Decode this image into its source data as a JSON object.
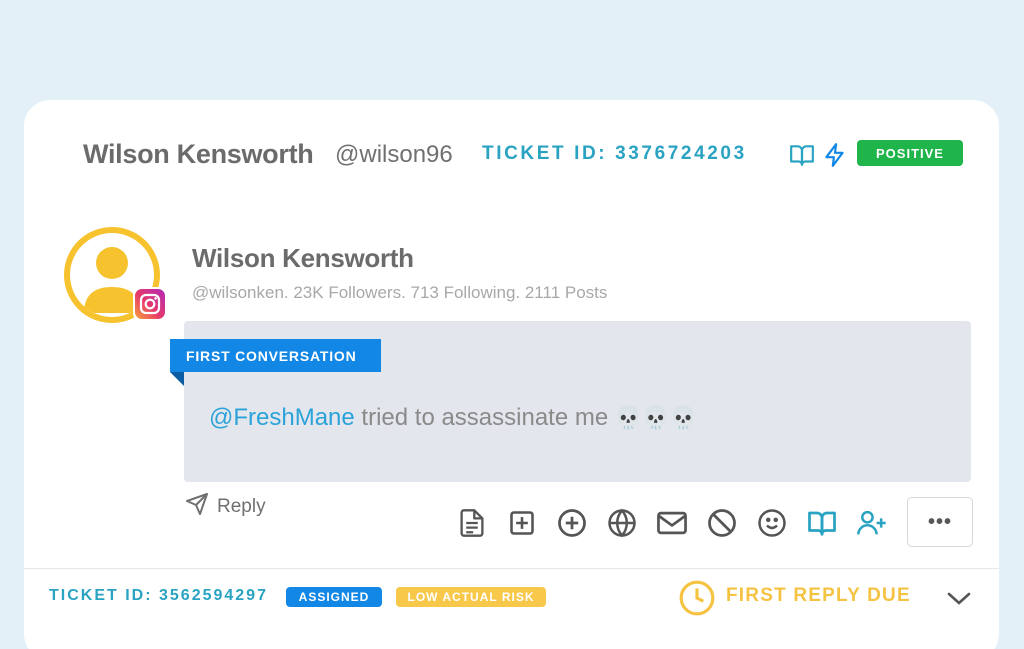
{
  "header": {
    "name": "Wilson Kensworth",
    "handle": "@wilson96",
    "ticket_id": "TICKET ID: 3376724203",
    "sentiment_badge": "POSITIVE",
    "icons": [
      "book-icon",
      "lightning-icon"
    ],
    "sentiment_color": "#1fb54a"
  },
  "post": {
    "author_name": "Wilson Kensworth",
    "meta": "@wilsonken. 23K Followers. 713 Following. 2111 Posts",
    "platform": "instagram",
    "ribbon": "FIRST CONVERSATION",
    "mention": "@FreshMane",
    "message": " tried to assassinate me ",
    "emoji": "💀💀💀"
  },
  "actions": {
    "reply_label": "Reply",
    "buttons": [
      "document-icon",
      "add-square-icon",
      "add-circle-icon",
      "globe-icon",
      "mail-icon",
      "block-icon",
      "smile-icon",
      "book-icon",
      "add-user-icon"
    ],
    "more_label": "•••"
  },
  "footer": {
    "ticket_id": "TICKET ID: 3562594297",
    "status_badge": "ASSIGNED",
    "risk_badge": "LOW ACTUAL RISK",
    "due_label": "FIRST REPLY DUE",
    "status_color": "#1387e6",
    "risk_color": "#f8c84a",
    "due_color": "#f5c242"
  },
  "colors": {
    "accent_teal": "#2aa3c2",
    "avatar_ring": "#f6c22d",
    "mention": "#2ba3d9"
  }
}
